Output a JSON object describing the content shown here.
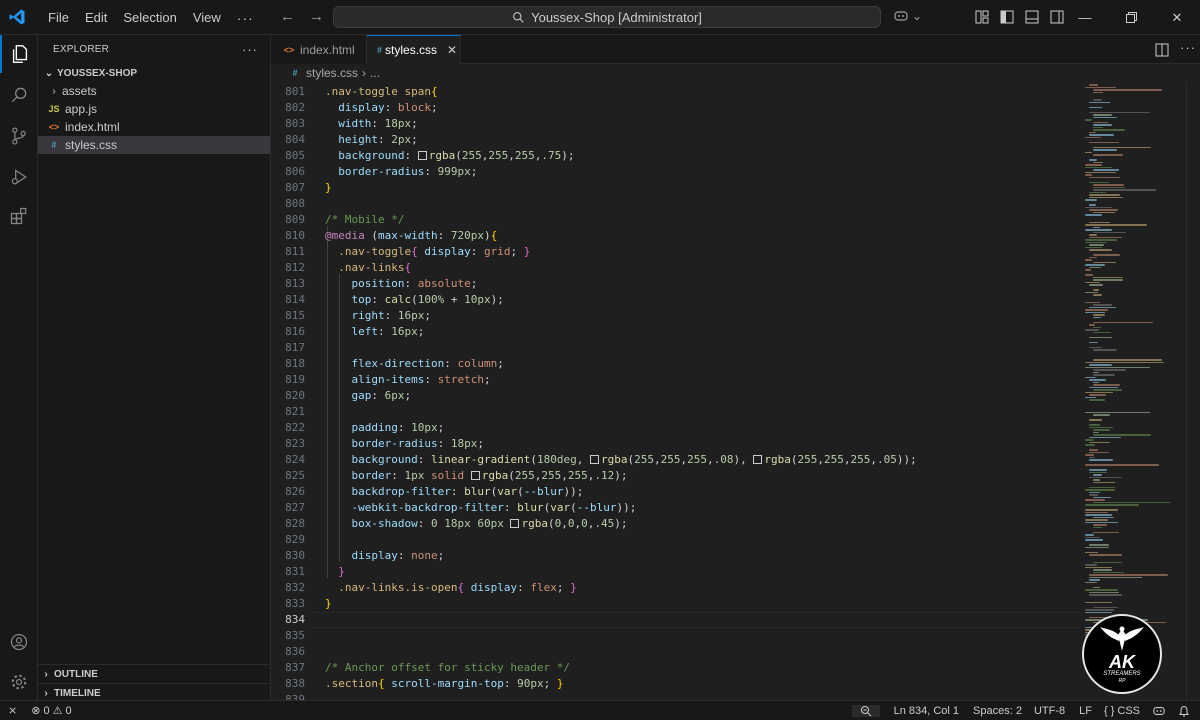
{
  "titlebar": {
    "menu": [
      "File",
      "Edit",
      "Selection",
      "View"
    ],
    "menu_more": "···",
    "command_center": "Youssex-Shop [Administrator]",
    "copilot_icon": "copilot-icon"
  },
  "activity_bar": [
    "explorer-icon",
    "search-icon",
    "source-control-icon",
    "run-debug-icon",
    "extensions-icon",
    "accounts-icon",
    "manage-gear-icon"
  ],
  "sidebar": {
    "title": "EXPLORER",
    "more": "···",
    "root_folder": "YOUSSEX-SHOP",
    "items": [
      {
        "name": "assets",
        "type": "folder",
        "icon": ""
      },
      {
        "name": "app.js",
        "type": "file",
        "icon": "JS"
      },
      {
        "name": "index.html",
        "type": "file",
        "icon": "<>"
      },
      {
        "name": "styles.css",
        "type": "file",
        "icon": "#"
      }
    ],
    "outline": "OUTLINE",
    "timeline": "TIMELINE"
  },
  "tabs": [
    {
      "label": "index.html",
      "icon": "<>",
      "active": false
    },
    {
      "label": "styles.css",
      "icon": "#",
      "active": true,
      "close": "✕"
    }
  ],
  "breadcrumb": {
    "icon": "#",
    "file": "styles.css",
    "more": "..."
  },
  "editor": {
    "current_line": 834,
    "lines": [
      {
        "n": 801,
        "t": ".nav-toggle span{"
      },
      {
        "n": 802,
        "t": "  display: block;"
      },
      {
        "n": 803,
        "t": "  width: 18px;"
      },
      {
        "n": 804,
        "t": "  height: 2px;"
      },
      {
        "n": 805,
        "t": "  background: rgba(255,255,255,.75);"
      },
      {
        "n": 806,
        "t": "  border-radius: 999px;"
      },
      {
        "n": 807,
        "t": "}"
      },
      {
        "n": 808,
        "t": ""
      },
      {
        "n": 809,
        "t": "/* Mobile */"
      },
      {
        "n": 810,
        "t": "@media (max-width: 720px){"
      },
      {
        "n": 811,
        "t": "  .nav-toggle{ display: grid; }"
      },
      {
        "n": 812,
        "t": "  .nav-links{"
      },
      {
        "n": 813,
        "t": "    position: absolute;"
      },
      {
        "n": 814,
        "t": "    top: calc(100% + 10px);"
      },
      {
        "n": 815,
        "t": "    right: 16px;"
      },
      {
        "n": 816,
        "t": "    left: 16px;"
      },
      {
        "n": 817,
        "t": ""
      },
      {
        "n": 818,
        "t": "    flex-direction: column;"
      },
      {
        "n": 819,
        "t": "    align-items: stretch;"
      },
      {
        "n": 820,
        "t": "    gap: 6px;"
      },
      {
        "n": 821,
        "t": ""
      },
      {
        "n": 822,
        "t": "    padding: 10px;"
      },
      {
        "n": 823,
        "t": "    border-radius: 18px;"
      },
      {
        "n": 824,
        "t": "    background: linear-gradient(180deg, rgba(255,255,255,.08), rgba(255,255,255,.05));"
      },
      {
        "n": 825,
        "t": "    border: 1px solid rgba(255,255,255,.12);"
      },
      {
        "n": 826,
        "t": "    backdrop-filter: blur(var(--blur));"
      },
      {
        "n": 827,
        "t": "    -webkit-backdrop-filter: blur(var(--blur));"
      },
      {
        "n": 828,
        "t": "    box-shadow: 0 18px 60px rgba(0,0,0,.45);"
      },
      {
        "n": 829,
        "t": ""
      },
      {
        "n": 830,
        "t": "    display: none;"
      },
      {
        "n": 831,
        "t": "  }"
      },
      {
        "n": 832,
        "t": "  .nav-links.is-open{ display: flex; }"
      },
      {
        "n": 833,
        "t": "}"
      },
      {
        "n": 834,
        "t": ""
      },
      {
        "n": 835,
        "t": ""
      },
      {
        "n": 836,
        "t": ""
      },
      {
        "n": 837,
        "t": "/* Anchor offset for sticky header */"
      },
      {
        "n": 838,
        "t": ".section{ scroll-margin-top: 90px; }"
      },
      {
        "n": 839,
        "t": ""
      }
    ]
  },
  "watermark": {
    "main": "AK",
    "sub": "STREAMERS",
    "tag": "RP"
  },
  "statusbar": {
    "remote_icon": "remote-icon",
    "errors": "0",
    "warnings": "0",
    "zoom_icon": "zoom-icon",
    "position": "Ln 834, Col 1",
    "spaces": "Spaces: 2",
    "encoding": "UTF-8",
    "eol": "LF",
    "language": "CSS",
    "language_icon": "{ }",
    "copilot_icon": "copilot-icon",
    "bell_icon": "bell-icon"
  },
  "colors": {
    "accent": "#0078d4",
    "selector": "#d7ba7d",
    "property": "#9cdcfe",
    "value": "#ce9178",
    "number": "#b5cea8",
    "comment": "#6a9955",
    "at_rule": "#c586c0"
  }
}
